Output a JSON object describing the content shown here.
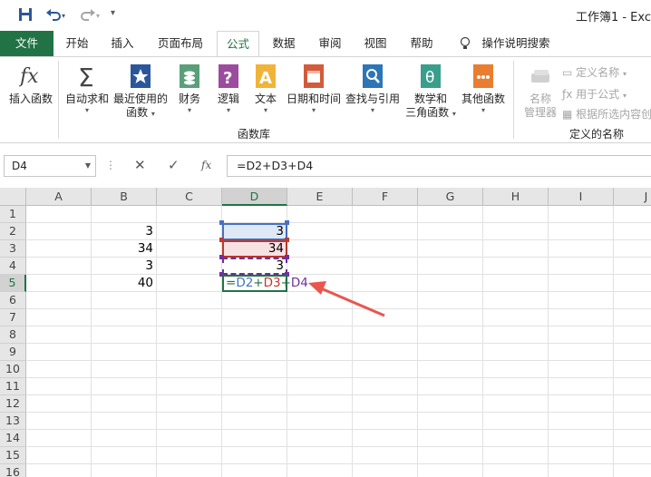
{
  "window": {
    "title": "工作簿1 - Exc"
  },
  "tabs": [
    {
      "label": "文件",
      "key": "file"
    },
    {
      "label": "开始",
      "key": "home"
    },
    {
      "label": "插入",
      "key": "insert"
    },
    {
      "label": "页面布局",
      "key": "page-layout"
    },
    {
      "label": "公式",
      "key": "formulas"
    },
    {
      "label": "数据",
      "key": "data"
    },
    {
      "label": "审阅",
      "key": "review"
    },
    {
      "label": "视图",
      "key": "view"
    },
    {
      "label": "帮助",
      "key": "help"
    },
    {
      "label": "操作说明搜索",
      "key": "tell-me"
    }
  ],
  "ribbon": {
    "insert_function": "插入函数",
    "autosum": "自动求和",
    "recent_l1": "最近使用的",
    "recent_l2": "函数",
    "financial": "财务",
    "logical": "逻辑",
    "text": "文本",
    "datetime": "日期和时间",
    "lookup": "查找与引用",
    "math_l1": "数学和",
    "math_l2": "三角函数",
    "more": "其他函数",
    "name_mgr_l1": "名称",
    "name_mgr_l2": "管理器",
    "define_name": "定义名称",
    "use_in_formula": "用于公式",
    "create_from_sel": "根据所选内容创",
    "group_library": "函数库",
    "group_names": "定义的名称"
  },
  "formula_bar": {
    "name_box": "D4",
    "fx": "fx",
    "formula": "=D2+D3+D4"
  },
  "sheet": {
    "columns": [
      "A",
      "B",
      "C",
      "D",
      "E",
      "F",
      "G",
      "H",
      "I",
      "J"
    ],
    "selected_column": "D",
    "rows": [
      "1",
      "2",
      "3",
      "4",
      "5",
      "6",
      "7",
      "8",
      "9",
      "10",
      "11",
      "12",
      "13",
      "14",
      "15",
      "16"
    ],
    "selected_row": "5",
    "cells": {
      "B2": "3",
      "B3": "34",
      "B4": "3",
      "B5": "40",
      "D2": "3",
      "D3": "34",
      "D4": "3"
    },
    "edit_formula_parts": [
      {
        "text": "=",
        "color": "#217346"
      },
      {
        "text": "D2",
        "color": "#4472c4"
      },
      {
        "text": "+",
        "color": "#217346"
      },
      {
        "text": "D3",
        "color": "#c0392b"
      },
      {
        "text": "+",
        "color": "#217346"
      },
      {
        "text": "D4",
        "color": "#7030a0"
      }
    ]
  },
  "colors": {
    "accent": "#217346",
    "ref_d2": "#4472c4",
    "ref_d3": "#c0392b",
    "ref_d4": "#7030a0",
    "arrow": "#e8564f"
  }
}
